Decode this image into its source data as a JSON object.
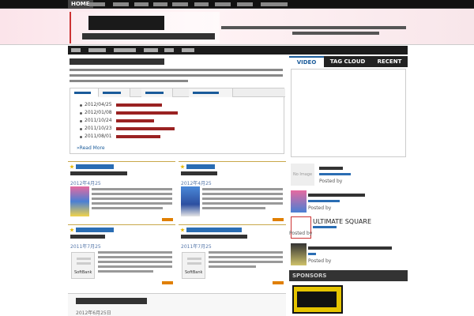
{
  "nav": {
    "home": "HOME"
  },
  "news": {
    "read_more": "»Read More",
    "dates": [
      "2012/04/25",
      "2012/01/08",
      "2011/10/24",
      "2011/10/23",
      "2011/08/01"
    ]
  },
  "posts": [
    {
      "date": "2012年4月25"
    },
    {
      "date": "2012年4月25"
    },
    {
      "date": "2011年7月25"
    },
    {
      "date": "2011年7月25"
    }
  ],
  "thumb_label": "SoftBank",
  "bottom_post": {
    "meta": "2012年6月25日"
  },
  "sidebar": {
    "tabs": [
      "VIDEO",
      "TAG CLOUD",
      "RECENT"
    ],
    "no_image": "No Image",
    "ultimate": "ULTIMATE SQUARE",
    "posted_by": "Posted by",
    "sponsors": "SPONSORS"
  },
  "colors": {
    "accent": "#1a5b9a",
    "header_pink": "#fbe4ea",
    "link_red": "#9a2222",
    "more_orange": "#e07f00"
  }
}
